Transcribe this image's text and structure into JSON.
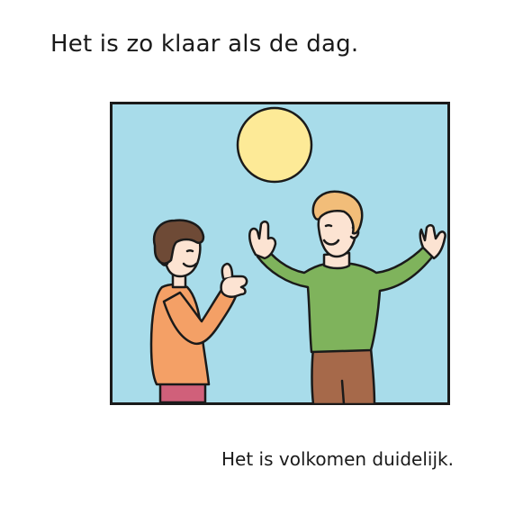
{
  "title": "Het is zo klaar als de dag.",
  "caption": "Het is volkomen duidelijk.",
  "illustration": {
    "colors": {
      "sky": "#a8dcea",
      "sun": "#fdea97",
      "outline": "#1a1a1a",
      "skin": "#fce3d2",
      "left_person_shirt": "#f4a066",
      "left_person_pants": "#d0607a",
      "left_person_hair": "#6e4a36",
      "right_person_shirt": "#7fb35c",
      "right_person_pants": "#a6694a",
      "right_person_hair": "#f2bd79"
    }
  }
}
